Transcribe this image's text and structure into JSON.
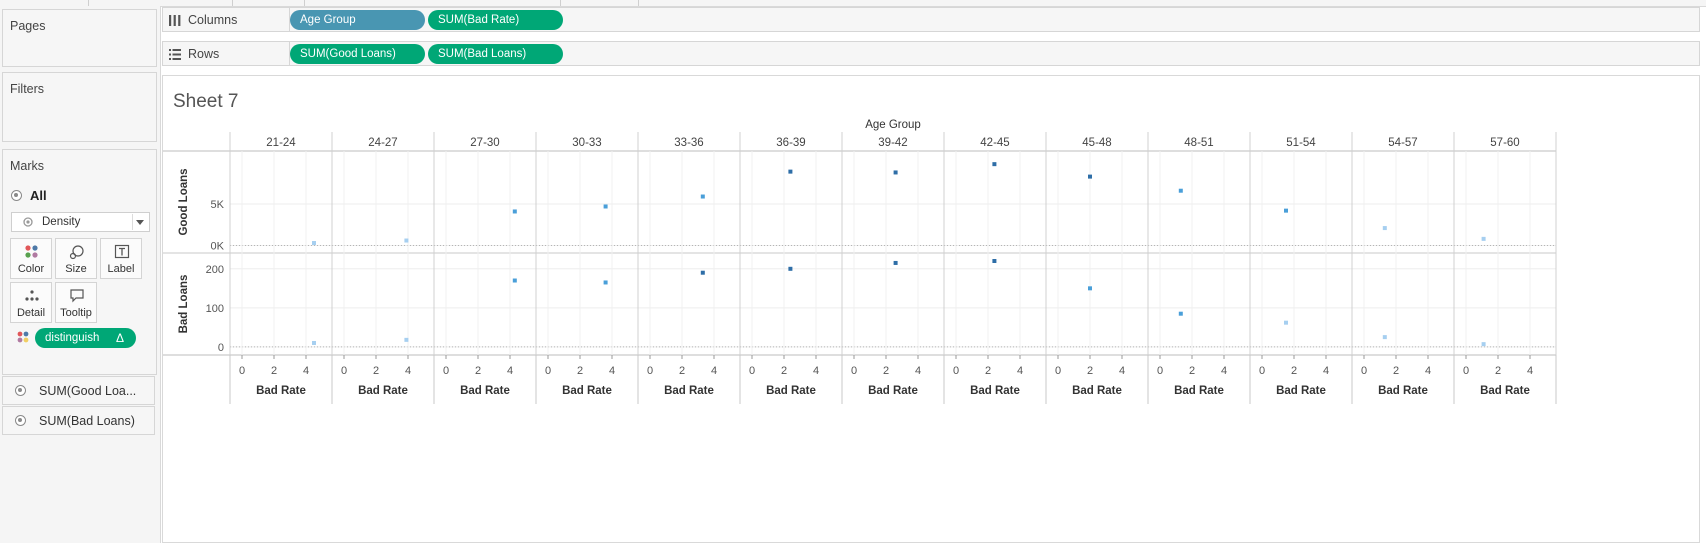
{
  "shelves": {
    "columns": {
      "label": "Columns",
      "pills": [
        "Age Group",
        "SUM(Bad Rate)"
      ]
    },
    "rows": {
      "label": "Rows",
      "pills": [
        "SUM(Good Loans)",
        "SUM(Bad Loans)"
      ]
    }
  },
  "cards": {
    "pages": {
      "title": "Pages"
    },
    "filters": {
      "title": "Filters"
    },
    "marks": {
      "title": "Marks",
      "all_label": "All",
      "mark_type": "Density",
      "buttons": [
        "Color",
        "Size",
        "Label",
        "Detail",
        "Tooltip"
      ],
      "color_pill": "distinguish",
      "color_pill_badge": "Δ",
      "measures": [
        "SUM(Good Loa...",
        "SUM(Bad Loans)"
      ]
    }
  },
  "colors": {
    "pill_dimension": "#4996b2",
    "pill_measure": "#00a776",
    "mark_dark": "#2e6ea7",
    "mark_mid": "#4a9fd9",
    "mark_light": "#a6cff0"
  },
  "sheet": {
    "title": "Sheet 7"
  },
  "chart_data": {
    "type": "scatter",
    "column_header": "Age Group",
    "panes": [
      "21-24",
      "24-27",
      "27-30",
      "30-33",
      "33-36",
      "36-39",
      "39-42",
      "42-45",
      "45-48",
      "48-51",
      "51-54",
      "54-57",
      "57-60"
    ],
    "xlabel": "Bad Rate",
    "xlim": [
      0,
      5
    ],
    "xticks": [
      "0",
      "2",
      "4"
    ],
    "rows": [
      {
        "ylabel": "Good Loans",
        "ylim": [
          -300,
          10300
        ],
        "yticks": [
          0,
          5000
        ],
        "ytick_labels": [
          "0K",
          "5K"
        ]
      },
      {
        "ylabel": "Bad Loans",
        "ylim": [
          -8,
          220
        ],
        "yticks": [
          0,
          100,
          200
        ],
        "ytick_labels": [
          "0",
          "100",
          "200"
        ]
      }
    ],
    "series": [
      {
        "x": [
          4.5,
          3.9,
          4.3,
          3.6,
          3.3,
          2.4,
          2.6,
          2.4,
          2.0,
          1.3,
          1.5,
          1.3,
          1.1
        ],
        "good_loans": [
          300,
          600,
          4100,
          4700,
          5900,
          8900,
          8800,
          9800,
          8300,
          6600,
          4200,
          2100,
          800
        ],
        "bad_loans": [
          10,
          18,
          170,
          165,
          190,
          200,
          215,
          220,
          150,
          85,
          62,
          25,
          7
        ]
      }
    ]
  }
}
